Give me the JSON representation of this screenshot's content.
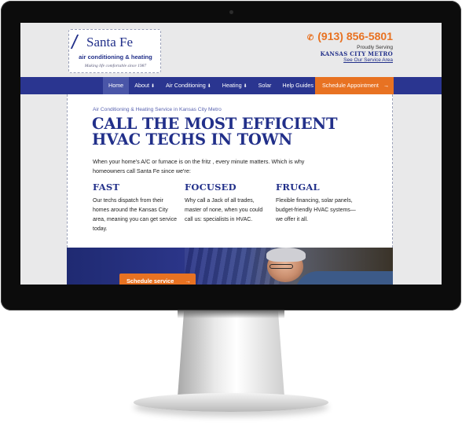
{
  "logo": {
    "name": "Santa Fe",
    "subtitle": "air conditioning & heating",
    "tagline": "Making life comfortable since 1987"
  },
  "contact": {
    "phone": "(913) 856-5801",
    "proudly": "Proudly Serving",
    "metro": "KANSAS CITY METRO",
    "area_link": "See Our Service Area"
  },
  "nav": {
    "items": [
      {
        "label": "Home",
        "caret": ""
      },
      {
        "label": "About",
        "caret": "⬇"
      },
      {
        "label": "Air Conditioning",
        "caret": "⬇"
      },
      {
        "label": "Heating",
        "caret": "⬇"
      },
      {
        "label": "Solar",
        "caret": ""
      },
      {
        "label": "Help Guides",
        "caret": ""
      }
    ],
    "cta": "Schedule Appointment",
    "cta_arrow": "→"
  },
  "content": {
    "kicker": "Air Conditioning & Heating Service in Kansas City Metro",
    "headline_1": "CALL THE MOST EFFICIENT",
    "headline_2": "HVAC TECHS IN TOWN",
    "intro": "When your home's A/C or furnace is on the fritz , every minute matters. Which is why homeowners call Santa Fe since we're:",
    "columns": [
      {
        "title": "FAST",
        "text": "Our techs dispatch from their homes around the Kansas City area, meaning you can get service today."
      },
      {
        "title": "FOCUSED",
        "text": "Why call a Jack of all trades, master of none, when you could call us: specialists in HVAC."
      },
      {
        "title": "FRUGAL",
        "text": "Flexible financing, solar panels, budget-friendly HVAC systems—we offer it all."
      }
    ]
  },
  "hero": {
    "button": "Schedule service",
    "button_arrow": "→"
  },
  "colors": {
    "brand_blue": "#2a3590",
    "accent_orange": "#e87222",
    "headline_blue": "#22308a"
  }
}
